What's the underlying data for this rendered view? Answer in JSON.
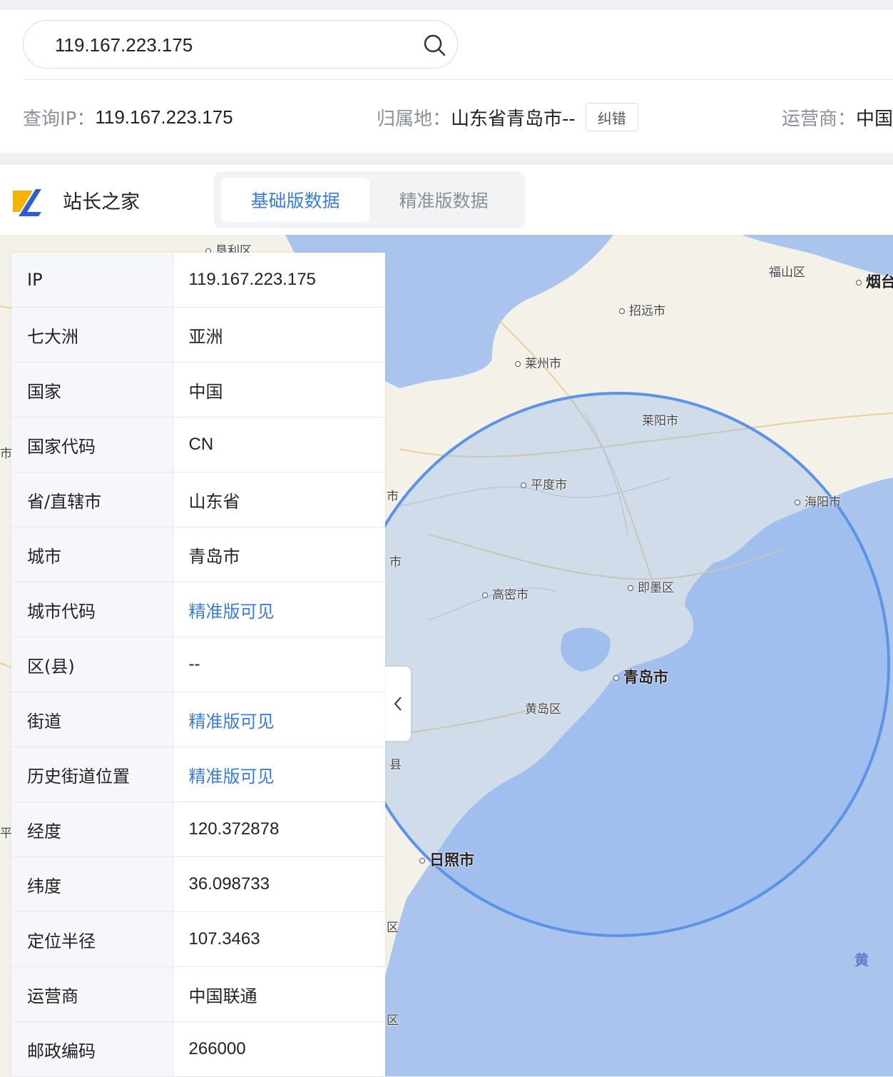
{
  "search": {
    "value": "119.167.223.175"
  },
  "summary": {
    "ip_label": "查询IP：",
    "ip_value": "119.167.223.175",
    "location_label": "归属地：",
    "location_value": "山东省青岛市--",
    "correct_button": "纠错",
    "isp_label": "运营商：",
    "isp_value": "中国联"
  },
  "brand": {
    "name": "站长之家"
  },
  "tabs": [
    {
      "label": "基础版数据",
      "active": true
    },
    {
      "label": "精准版数据",
      "active": false
    }
  ],
  "table": {
    "rows": [
      {
        "key": "IP",
        "value": "119.167.223.175"
      },
      {
        "key": "七大洲",
        "value": "亚洲"
      },
      {
        "key": "国家",
        "value": "中国"
      },
      {
        "key": "国家代码",
        "value": "CN"
      },
      {
        "key": "省/直辖市",
        "value": "山东省"
      },
      {
        "key": "城市",
        "value": "青岛市"
      },
      {
        "key": "城市代码",
        "value": "精准版可见"
      },
      {
        "key": "区(县)",
        "value": "--"
      },
      {
        "key": "街道",
        "value": "精准版可见"
      },
      {
        "key": "历史街道位置",
        "value": "精准版可见"
      },
      {
        "key": "经度",
        "value": "120.372878"
      },
      {
        "key": "纬度",
        "value": "36.098733"
      },
      {
        "key": "定位半径",
        "value": "107.3463"
      },
      {
        "key": "运营商",
        "value": "中国联通"
      },
      {
        "key": "邮政编码",
        "value": "266000"
      }
    ]
  },
  "map": {
    "labels": {
      "kenli": "垦利区",
      "fushan": "福山区",
      "yantai": "烟台",
      "zhaoyuan": "招远市",
      "laizhou": "莱州市",
      "laiyang": "莱阳市",
      "pingdu": "平度市",
      "haiyang": "海阳市",
      "gaomi": "高密市",
      "jimo": "即墨区",
      "qingdao": "青岛市",
      "huangdao": "黄岛区",
      "rizhao": "日照市",
      "huang": "黄",
      "frag_shi1": "市",
      "frag_shi2": "市",
      "frag_shi3": "市",
      "frag_xian": "县",
      "frag_qu1": "区",
      "frag_qu2": "区",
      "frag_ping": "平"
    },
    "colors": {
      "land": "#f4f1e8",
      "sea": "#aac4ee",
      "circle_fill": "#8fb4ee",
      "circle_stroke": "#5b93e8",
      "accent": "#3a7be0"
    }
  }
}
